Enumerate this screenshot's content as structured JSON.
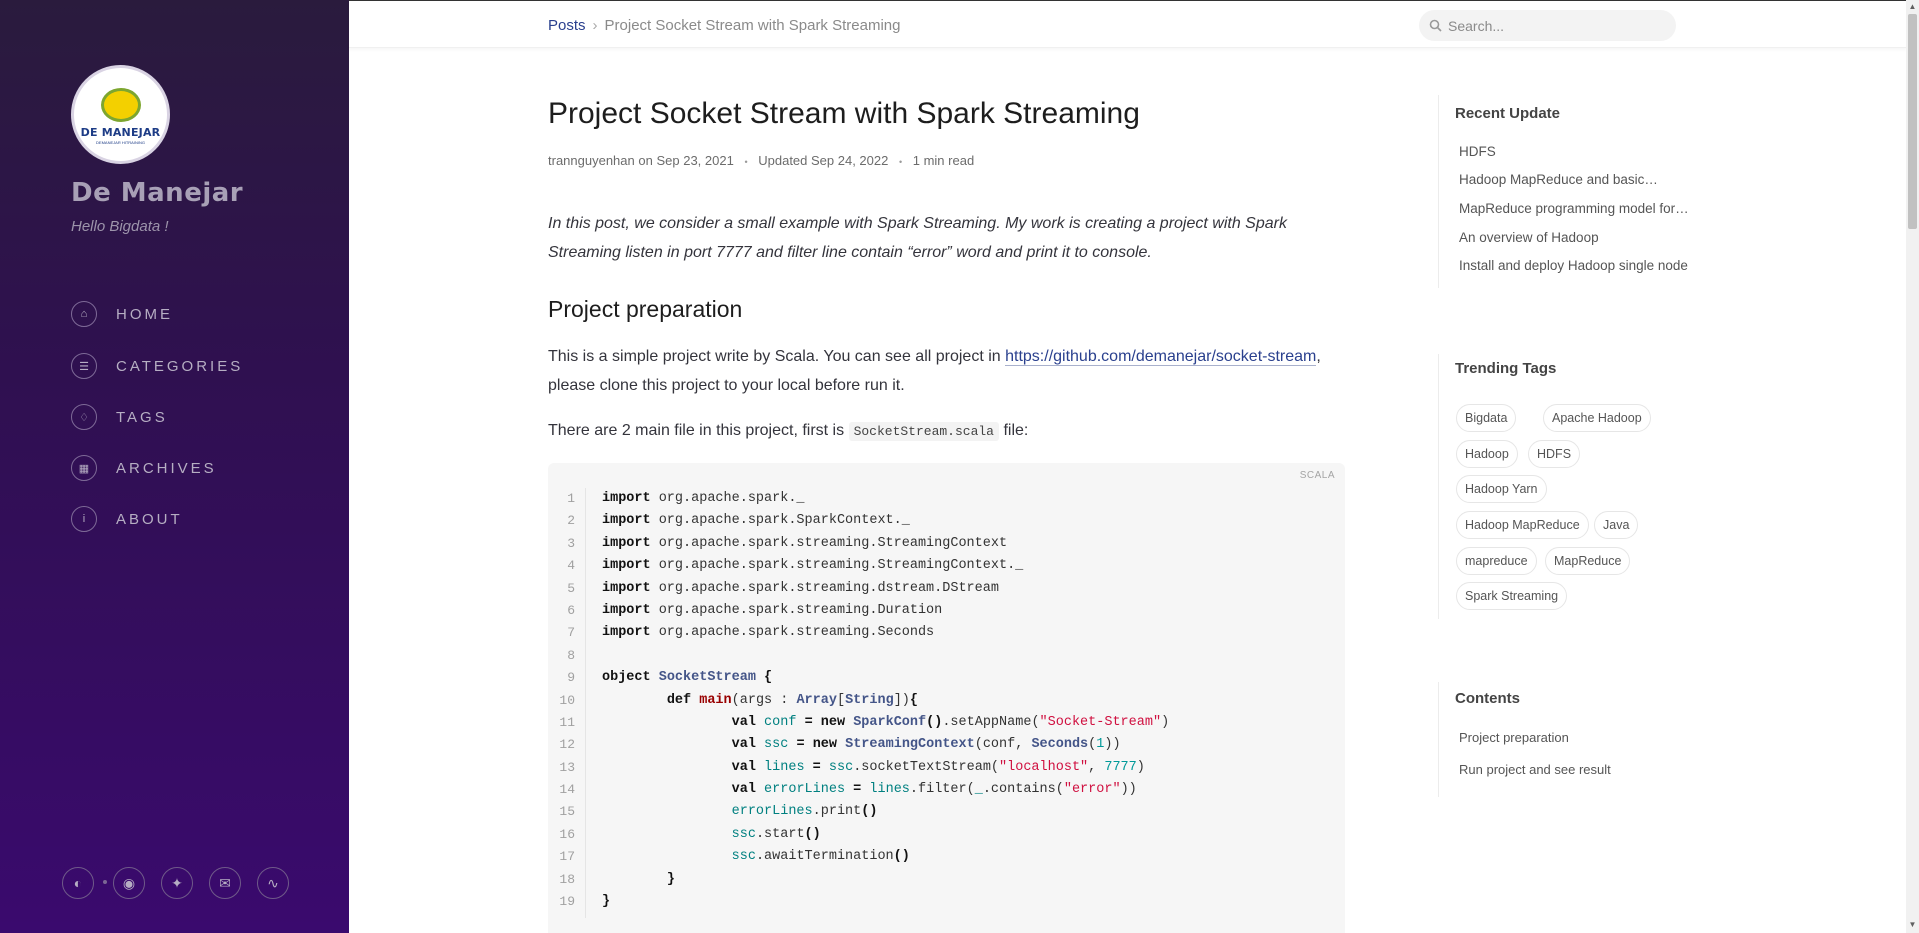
{
  "sidebar": {
    "logo_text": "DE MANEJAR",
    "logo_sub": "DEMANEJAR HITRAINING",
    "title": "De Manejar",
    "subtitle": "Hello Bigdata !",
    "nav": [
      {
        "label": "HOME",
        "icon": "home-icon"
      },
      {
        "label": "CATEGORIES",
        "icon": "list-icon"
      },
      {
        "label": "TAGS",
        "icon": "tags-icon"
      },
      {
        "label": "ARCHIVES",
        "icon": "archive-icon"
      },
      {
        "label": "ABOUT",
        "icon": "info-icon"
      }
    ],
    "bottom_buttons": [
      "theme-toggle-icon",
      "github-icon",
      "twitter-icon",
      "email-icon",
      "rss-icon"
    ]
  },
  "topbar": {
    "breadcrumb_root": "Posts",
    "breadcrumb_current": "Project Socket Stream with Spark Streaming",
    "search_placeholder": "Search..."
  },
  "post": {
    "title": "Project Socket Stream with Spark Streaming",
    "author": "trannguyenhan",
    "on": "on",
    "date": "Sep 23, 2021",
    "updated": "Updated Sep 24, 2022",
    "read_time": "1 min read",
    "intro": "In this post, we consider a small example with Spark Streaming. My work is creating a project with Spark Streaming listen in port 7777 and filter line contain “error” word and print it to console.",
    "section_title": "Project preparation",
    "para1_before": "This is a simple project write by Scala. You can see all project in ",
    "para1_link": "https://github.com/demanejar/socket-stream",
    "para1_after": ", please clone this project to your local before run it.",
    "para2_before": "There are 2 main file in this project, first is ",
    "para2_code": "SocketStream.scala",
    "para2_after": " file:",
    "code_lang": "SCALA",
    "line_numbers": [
      "1",
      "2",
      "3",
      "4",
      "5",
      "6",
      "7",
      "8",
      "9",
      "10",
      "11",
      "12",
      "13",
      "14",
      "15",
      "16",
      "17",
      "18",
      "19"
    ]
  },
  "recent": {
    "title": "Recent Update",
    "items": [
      "HDFS",
      "Hadoop MapReduce and basic…",
      "MapReduce programming model for…",
      "An overview of Hadoop",
      "Install and deploy Hadoop single node"
    ]
  },
  "tags": {
    "title": "Trending Tags",
    "items": [
      "Bigdata",
      "Apache Hadoop",
      "Hadoop",
      "HDFS",
      "Hadoop Yarn",
      "Hadoop MapReduce",
      "Java",
      "mapreduce",
      "MapReduce",
      "Spark Streaming"
    ]
  },
  "toc": {
    "title": "Contents",
    "items": [
      "Project preparation",
      "Run project and see result"
    ]
  },
  "colors": {
    "sidebar_top": "#2a1b3d",
    "sidebar_bottom": "#3a0a6e",
    "link": "#2a408e",
    "string": "#d01040",
    "type": "#445588"
  }
}
